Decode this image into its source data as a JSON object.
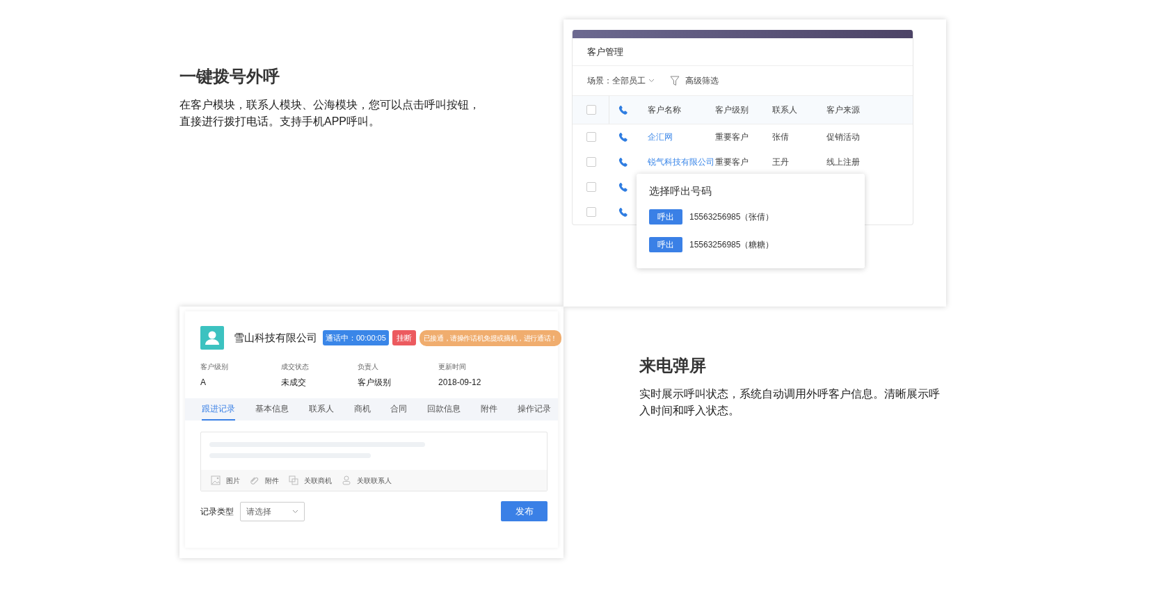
{
  "feature_call": {
    "title": "一键拨号外呼",
    "description": "在客户模块，联系人模块、公海模块，您可以点击呼叫按钮，直接进行拨打电话。支持手机APP呼叫。"
  },
  "customer_list": {
    "title": "客户管理",
    "scene_label": "场景：",
    "scene_value": "全部员工",
    "filter_label": "高级筛选",
    "header_checked": false,
    "columns": [
      "客户名称",
      "客户级别",
      "联系人",
      "客户来源"
    ],
    "rows": [
      {
        "checked": false,
        "cells": [
          "企汇网",
          "重要客户",
          "张倩",
          "促销活动"
        ]
      },
      {
        "checked": false,
        "cells": [
          "锐气科技有限公司",
          "重要客户",
          "王丹",
          "线上注册"
        ]
      },
      {
        "checked": false,
        "cells": []
      },
      {
        "checked": false,
        "cells": []
      }
    ],
    "popup": {
      "title": "选择呼出号码",
      "options": [
        {
          "button": "呼出",
          "number": "15563256985（张倩）"
        },
        {
          "button": "呼出",
          "number": "15563256985（糖糖）"
        }
      ]
    }
  },
  "call_screen": {
    "company": "雪山科技有限公司",
    "call_status": "通话中：00:00:05",
    "hangup": "挂断",
    "notice": "已接通，请操作话机免提或摘机，进行通话！",
    "info": [
      {
        "label": "客户级别",
        "value": "A"
      },
      {
        "label": "成交状态",
        "value": "未成交"
      },
      {
        "label": "负责人",
        "value": "客户级别"
      },
      {
        "label": "更新时间",
        "value": "2018-09-12"
      }
    ],
    "tabs": [
      {
        "label": "跟进记录",
        "selected": true
      },
      {
        "label": "基本信息",
        "selected": false
      },
      {
        "label": "联系人",
        "selected": false
      },
      {
        "label": "商机",
        "selected": false
      },
      {
        "label": "合同",
        "selected": false
      },
      {
        "label": "回款信息",
        "selected": false
      },
      {
        "label": "附件",
        "selected": false
      },
      {
        "label": "操作记录",
        "selected": false
      }
    ],
    "toolbar": [
      {
        "kind": "image",
        "label": "图片"
      },
      {
        "kind": "attachment",
        "label": "附件"
      },
      {
        "kind": "opportunity",
        "label": "关联商机"
      },
      {
        "kind": "contact",
        "label": "关联联系人"
      }
    ],
    "record_type_label": "记录类型",
    "record_type_placeholder": "请选择",
    "publish": "发布"
  },
  "feature_popup": {
    "title": "来电弹屏",
    "description": "实时展示呼叫状态，系统自动调用外呼客户信息。清晰展示呼入时间和呼入状态。"
  }
}
